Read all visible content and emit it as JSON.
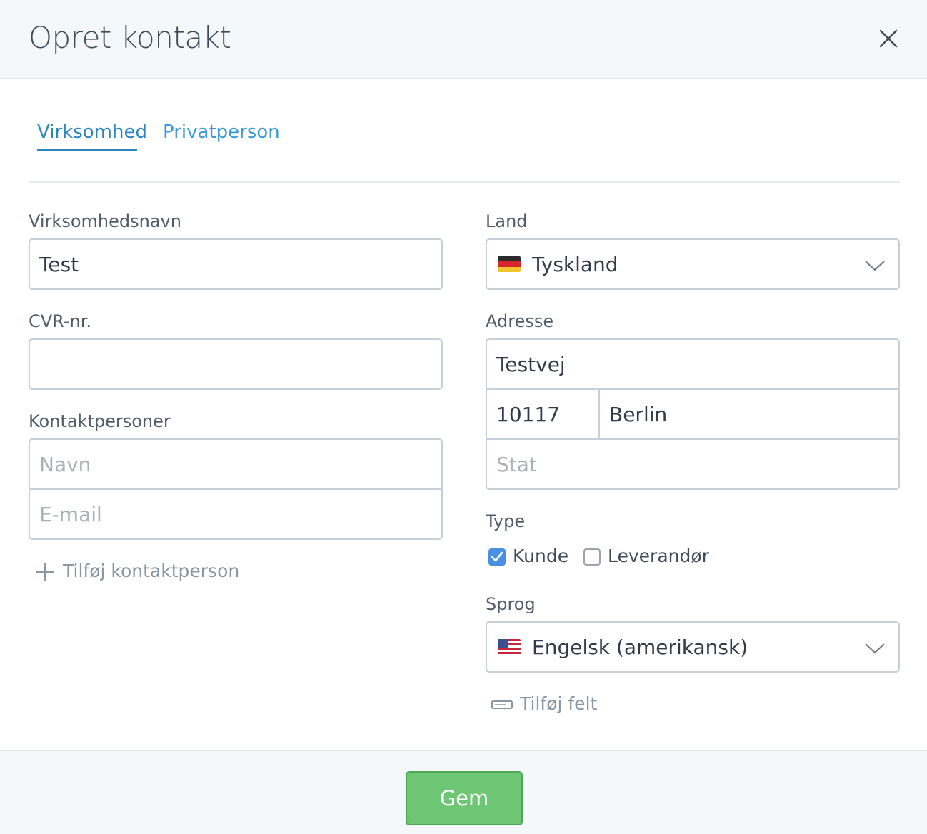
{
  "header": {
    "title": "Opret kontakt",
    "close_icon": "close-icon"
  },
  "tabs": [
    {
      "label": "Virksomhed",
      "active": true
    },
    {
      "label": "Privatperson",
      "active": false
    }
  ],
  "left": {
    "company_name": {
      "label": "Virksomhedsnavn",
      "value": "Test"
    },
    "cvr": {
      "label": "CVR-nr.",
      "value": ""
    },
    "contacts": {
      "label": "Kontaktpersoner",
      "name_placeholder": "Navn",
      "email_placeholder": "E-mail",
      "add_label": "Tilføj kontaktperson"
    }
  },
  "right": {
    "country": {
      "label": "Land",
      "value": "Tyskland",
      "flag": "germany-flag"
    },
    "address": {
      "label": "Adresse",
      "street": "Testvej",
      "zip": "10117",
      "city": "Berlin",
      "state_placeholder": "Stat"
    },
    "type": {
      "label": "Type",
      "options": [
        {
          "label": "Kunde",
          "checked": true
        },
        {
          "label": "Leverandør",
          "checked": false
        }
      ]
    },
    "language": {
      "label": "Sprog",
      "value": "Engelsk (amerikansk)",
      "flag": "usa-flag"
    },
    "add_field_label": "Tilføj felt"
  },
  "footer": {
    "save_label": "Gem"
  },
  "colors": {
    "accent": "#2c85c1",
    "save": "#6cc673",
    "checkbox": "#4a90e2"
  }
}
